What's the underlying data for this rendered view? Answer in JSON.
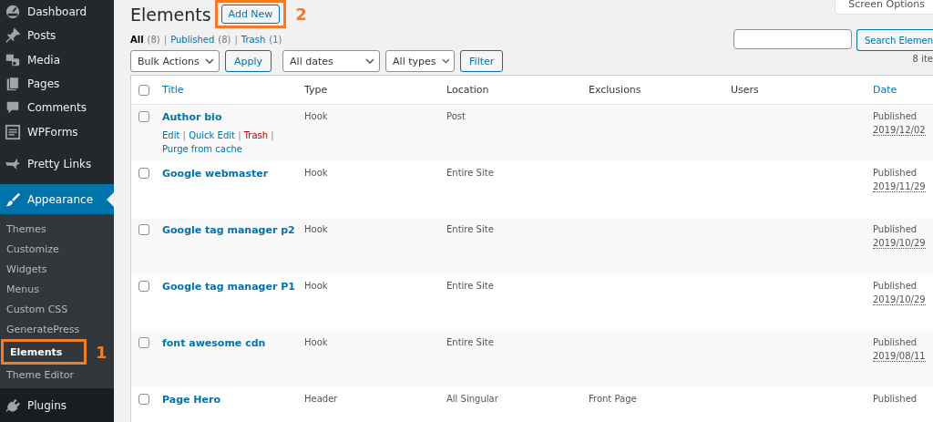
{
  "sidebar": {
    "items": [
      {
        "label": "Dashboard",
        "selected": false
      },
      {
        "label": "Posts",
        "selected": false
      },
      {
        "label": "Media",
        "selected": false
      },
      {
        "label": "Pages",
        "selected": false
      },
      {
        "label": "Comments",
        "selected": false
      },
      {
        "label": "WPForms",
        "selected": false
      },
      {
        "label": "Pretty Links",
        "selected": false
      },
      {
        "label": "Appearance",
        "selected": true,
        "children": [
          {
            "label": "Themes",
            "selected": false
          },
          {
            "label": "Customize",
            "selected": false
          },
          {
            "label": "Widgets",
            "selected": false
          },
          {
            "label": "Menus",
            "selected": false
          },
          {
            "label": "Custom CSS",
            "selected": false
          },
          {
            "label": "GeneratePress",
            "selected": false
          },
          {
            "label": "Elements",
            "selected": true,
            "callout": "1"
          },
          {
            "label": "Theme Editor",
            "selected": false
          }
        ]
      },
      {
        "label": "Plugins",
        "selected": false
      }
    ]
  },
  "screen_options": "Screen Options",
  "page": {
    "title": "Elements",
    "add_new": {
      "label": "Add New",
      "callout": "2"
    }
  },
  "views": [
    {
      "label": "All",
      "count": "(8)",
      "selected": true
    },
    {
      "label": "Published",
      "count": "(8)",
      "selected": false
    },
    {
      "label": "Trash",
      "count": "(1)",
      "selected": false
    }
  ],
  "view_separator": "|",
  "search": {
    "button": "Search Elemen"
  },
  "filters": {
    "bulk_actions": "Bulk Actions",
    "apply": "Apply",
    "dates": "All dates",
    "types": "All types",
    "filter": "Filter"
  },
  "item_count": "8 ite",
  "table": {
    "select_all_checked": false,
    "columns": [
      {
        "label": "Title",
        "sortable": true
      },
      {
        "label": "Type",
        "sortable": false
      },
      {
        "label": "Location",
        "sortable": false
      },
      {
        "label": "Exclusions",
        "sortable": false
      },
      {
        "label": "Users",
        "sortable": false
      },
      {
        "label": "Date",
        "sortable": true
      }
    ],
    "action_separator": "|",
    "rows": [
      {
        "title": "Author bio",
        "type": "Hook",
        "location": "Post",
        "status": "Published",
        "date": "2019/12/02",
        "checked": false,
        "actions": [
          {
            "label": "Edit",
            "kind": "link"
          },
          {
            "label": "Quick Edit",
            "kind": "link"
          },
          {
            "label": "Trash",
            "kind": "delete"
          },
          {
            "label": "Purge from cache",
            "kind": "link"
          }
        ]
      },
      {
        "title": "Google webmaster",
        "type": "Hook",
        "location": "Entire Site",
        "status": "Published",
        "date": "2019/11/29",
        "checked": false
      },
      {
        "title": "Google tag manager p2",
        "type": "Hook",
        "location": "Entire Site",
        "status": "Published",
        "date": "2019/10/29",
        "checked": false
      },
      {
        "title": "Google tag manager P1",
        "type": "Hook",
        "location": "Entire Site",
        "status": "Published",
        "date": "2019/10/29",
        "checked": false
      },
      {
        "title": "font awesome cdn",
        "type": "Hook",
        "location": "Entire Site",
        "status": "Published",
        "date": "2019/08/11",
        "checked": false
      },
      {
        "title": "Page Hero",
        "type": "Header",
        "location": "All Singular",
        "exclusions": "Front Page",
        "status": "Published",
        "checked": false
      }
    ]
  }
}
